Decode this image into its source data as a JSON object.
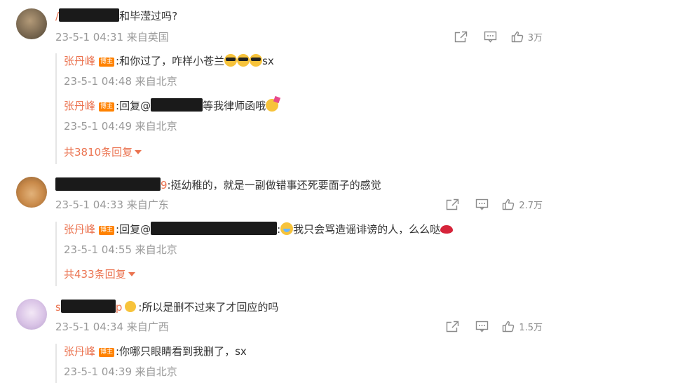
{
  "comments": [
    {
      "text_tail": "和毕滢过吗?",
      "time": "23-5-1 04:31",
      "location": "来自英国",
      "likes": "3万",
      "replies": [
        {
          "name": "张丹峰",
          "badge": "博主",
          "text": ":和你过了，咋样小苍兰",
          "tail": "sx",
          "time": "23-5-1 04:48",
          "location": "来自北京"
        },
        {
          "name": "张丹峰",
          "badge": "博主",
          "text": ":回复@",
          "tail": "等我律师函哦",
          "time": "23-5-1 04:49",
          "location": "来自北京"
        }
      ],
      "more_replies": "共3810条回复"
    },
    {
      "name_tail": "9",
      "text": ":挺幼稚的，就是一副做错事还死要面子的感觉",
      "time": "23-5-1 04:33",
      "location": "来自广东",
      "likes": "2.7万",
      "replies": [
        {
          "name": "张丹峰",
          "badge": "博主",
          "text": ":回复@",
          "tail": ":",
          "tail2": "我只会骂造谣诽谤的人，么么哒",
          "time": "23-5-1 04:55",
          "location": "来自北京"
        }
      ],
      "more_replies": "共433条回复"
    },
    {
      "name_head": "s",
      "name_tail": "p",
      "text": ":所以是删不过来了才回应的吗",
      "time": "23-5-1 04:34",
      "location": "来自广西",
      "likes": "1.5万",
      "replies": [
        {
          "name": "张丹峰",
          "badge": "博主",
          "text": ":你哪只眼睛看到我删了，sx",
          "time": "23-5-1 04:39",
          "location": "来自北京"
        }
      ]
    }
  ],
  "icons": {
    "share": "share-icon",
    "comment": "comment-icon",
    "like": "thumbs-up-icon"
  },
  "colors": {
    "username": "#eb7350",
    "meta": "#999999",
    "badge": "#ff8200"
  }
}
